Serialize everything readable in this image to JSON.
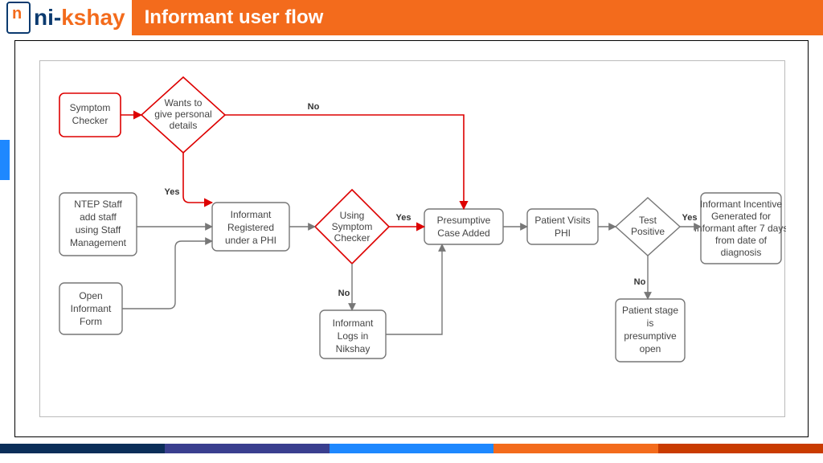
{
  "brand": {
    "ni": "ni-",
    "kshay": "kshay"
  },
  "title": "Informant user flow",
  "nodes": {
    "symptom_checker": [
      "Symptom",
      "Checker"
    ],
    "wants_details": [
      "Wants to",
      "give personal",
      "details"
    ],
    "ntep_staff": [
      "NTEP Staff",
      "add staff",
      "using Staff",
      "Management"
    ],
    "open_form": [
      "Open",
      "Informant",
      "Form"
    ],
    "informant_reg": [
      "Informant",
      "Registered",
      "under a  PHI"
    ],
    "using_symptom": [
      "Using",
      "Symptom",
      "Checker"
    ],
    "informant_logs": [
      "Informant",
      "Logs in",
      "Nikshay"
    ],
    "presumptive": [
      "Presumptive",
      "Case Added"
    ],
    "patient_visits": [
      "Patient Visits",
      "PHI"
    ],
    "test_positive": [
      "Test",
      "Positive"
    ],
    "stage_open": [
      "Patient stage",
      "is",
      "presumptive",
      "open"
    ],
    "incentive": [
      "Informant Incentive",
      "Generated for",
      "Informant after 7 days",
      "from date of",
      "diagnosis"
    ]
  },
  "edges": {
    "yes": "Yes",
    "no": "No"
  }
}
